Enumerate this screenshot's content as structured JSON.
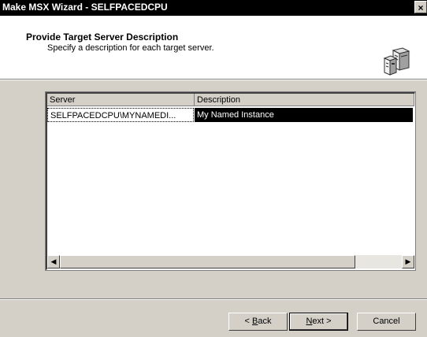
{
  "window": {
    "title": "Make MSX Wizard - SELFPACEDCPU",
    "close_glyph": "×"
  },
  "header": {
    "title": "Provide Target Server Description",
    "subtitle": "Specify a description for each target server.",
    "icon": "server-group-icon"
  },
  "listview": {
    "columns": [
      "Server",
      "Description"
    ],
    "rows": [
      {
        "server": "SELFPACEDCPU\\MYNAMEDI...",
        "description": "My Named Instance",
        "selected": true
      }
    ],
    "scroll_left_glyph": "◀",
    "scroll_right_glyph": "▶"
  },
  "buttons": {
    "back": {
      "before": "< ",
      "mnemonic": "B",
      "after": "ack"
    },
    "next": {
      "mnemonic": "N",
      "after": "ext >"
    },
    "cancel": "Cancel"
  },
  "colors": {
    "dialog_bg": "#d4d0c8",
    "titlebar_bg": "#000000",
    "selection_bg": "#000000",
    "selection_fg": "#ffffff"
  }
}
